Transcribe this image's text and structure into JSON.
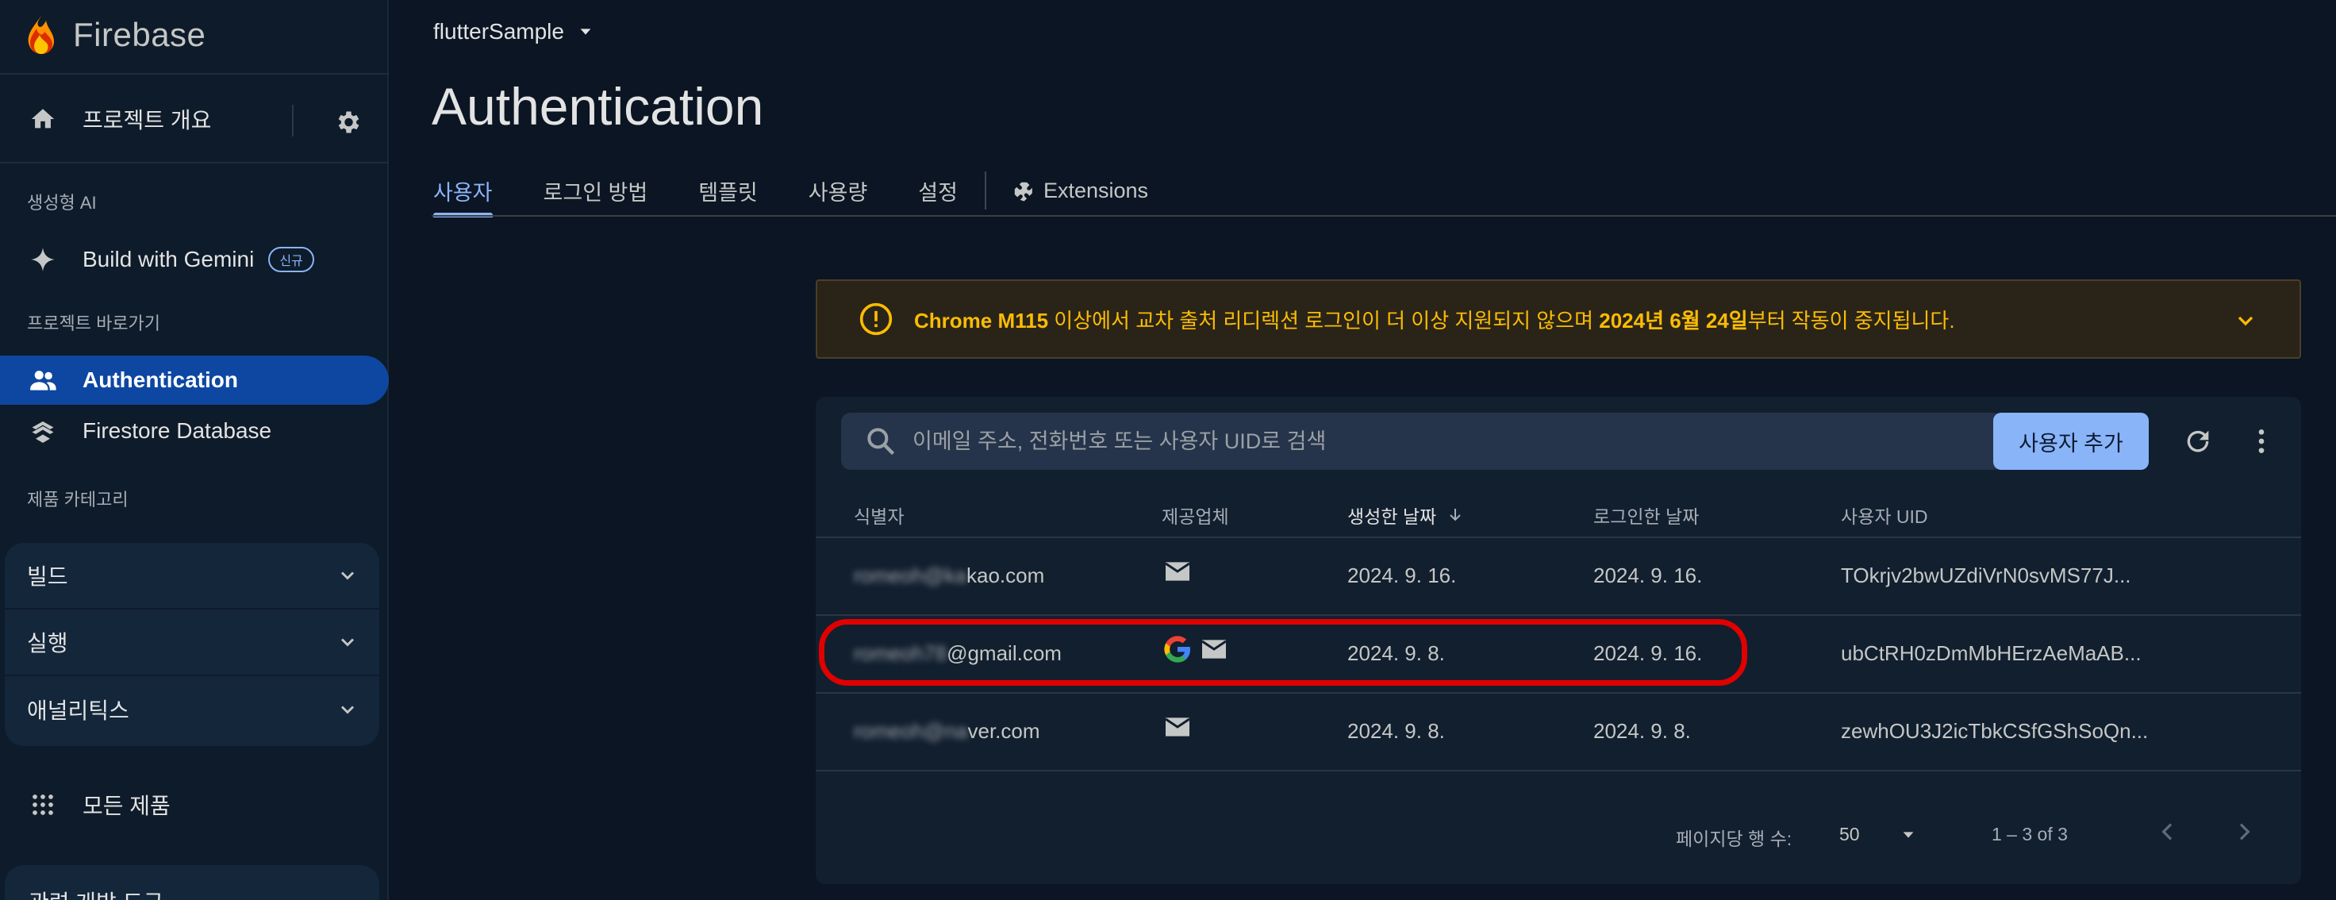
{
  "app": {
    "name": "Firebase"
  },
  "sidebar": {
    "overview_label": "프로젝트 개요",
    "section_genai": "생성형 AI",
    "gemini_label": "Build with Gemini",
    "gemini_badge": "신규",
    "section_shortcuts": "프로젝트 바로가기",
    "items": [
      {
        "label": "Authentication",
        "icon": "people-icon",
        "active": true
      },
      {
        "label": "Firestore Database",
        "icon": "firestore-icon",
        "active": false
      }
    ],
    "section_categories": "제품 카테고리",
    "categories": [
      {
        "label": "빌드"
      },
      {
        "label": "실행"
      },
      {
        "label": "애널리틱스"
      }
    ],
    "all_products": "모든 제품",
    "dev_tools": "관련 개발 도구"
  },
  "header": {
    "project": "flutterSample",
    "title": "Authentication"
  },
  "tabs": [
    {
      "label": "사용자",
      "active": true
    },
    {
      "label": "로그인 방법",
      "active": false
    },
    {
      "label": "템플릿",
      "active": false
    },
    {
      "label": "사용량",
      "active": false
    },
    {
      "label": "설정",
      "active": false
    }
  ],
  "extensions_tab": "Extensions",
  "banner": {
    "prefix": "Chrome M115",
    "middle": " 이상에서 교차 출처 리디렉션 로그인이 더 이상 지원되지 않으며 ",
    "date": "2024년 6월 24일",
    "suffix": "부터 작동이 중지됩니다.",
    "color": "#fbbc04"
  },
  "search": {
    "placeholder": "이메일 주소, 전화번호 또는 사용자 UID로 검색"
  },
  "add_user_label": "사용자 추가",
  "table": {
    "headers": {
      "identifier": "식별자",
      "providers": "제공업체",
      "created": "생성한 날짜",
      "signed_in": "로그인한 날짜",
      "uid": "사용자 UID"
    },
    "rows": [
      {
        "id_hidden": "romeoh@ka",
        "id_visible": "kao.com",
        "providers": [
          "mail-icon"
        ],
        "created": "2024. 9. 16.",
        "signed_in": "2024. 9. 16.",
        "uid": "TOkrjv2bwUZdiVrN0svMS77J..."
      },
      {
        "id_hidden": "romeoh78",
        "id_visible": "@gmail.com",
        "providers": [
          "google-icon",
          "mail-icon"
        ],
        "created": "2024. 9. 8.",
        "signed_in": "2024. 9. 16.",
        "uid": "ubCtRH0zDmMbHErzAeMaAB..."
      },
      {
        "id_hidden": "romeoh@na",
        "id_visible": "ver.com",
        "providers": [
          "mail-icon"
        ],
        "created": "2024. 9. 8.",
        "signed_in": "2024. 9. 8.",
        "uid": "zewhOU3J2icTbkCSfGShSoQn..."
      }
    ]
  },
  "pagination": {
    "rows_per_page_label": "페이지당 행 수:",
    "rows_per_page": "50",
    "range": "1 – 3 of 3"
  },
  "colors": {
    "accent": "#8ab4f8",
    "active_nav": "#0d47a1",
    "highlight": "#e00000"
  }
}
